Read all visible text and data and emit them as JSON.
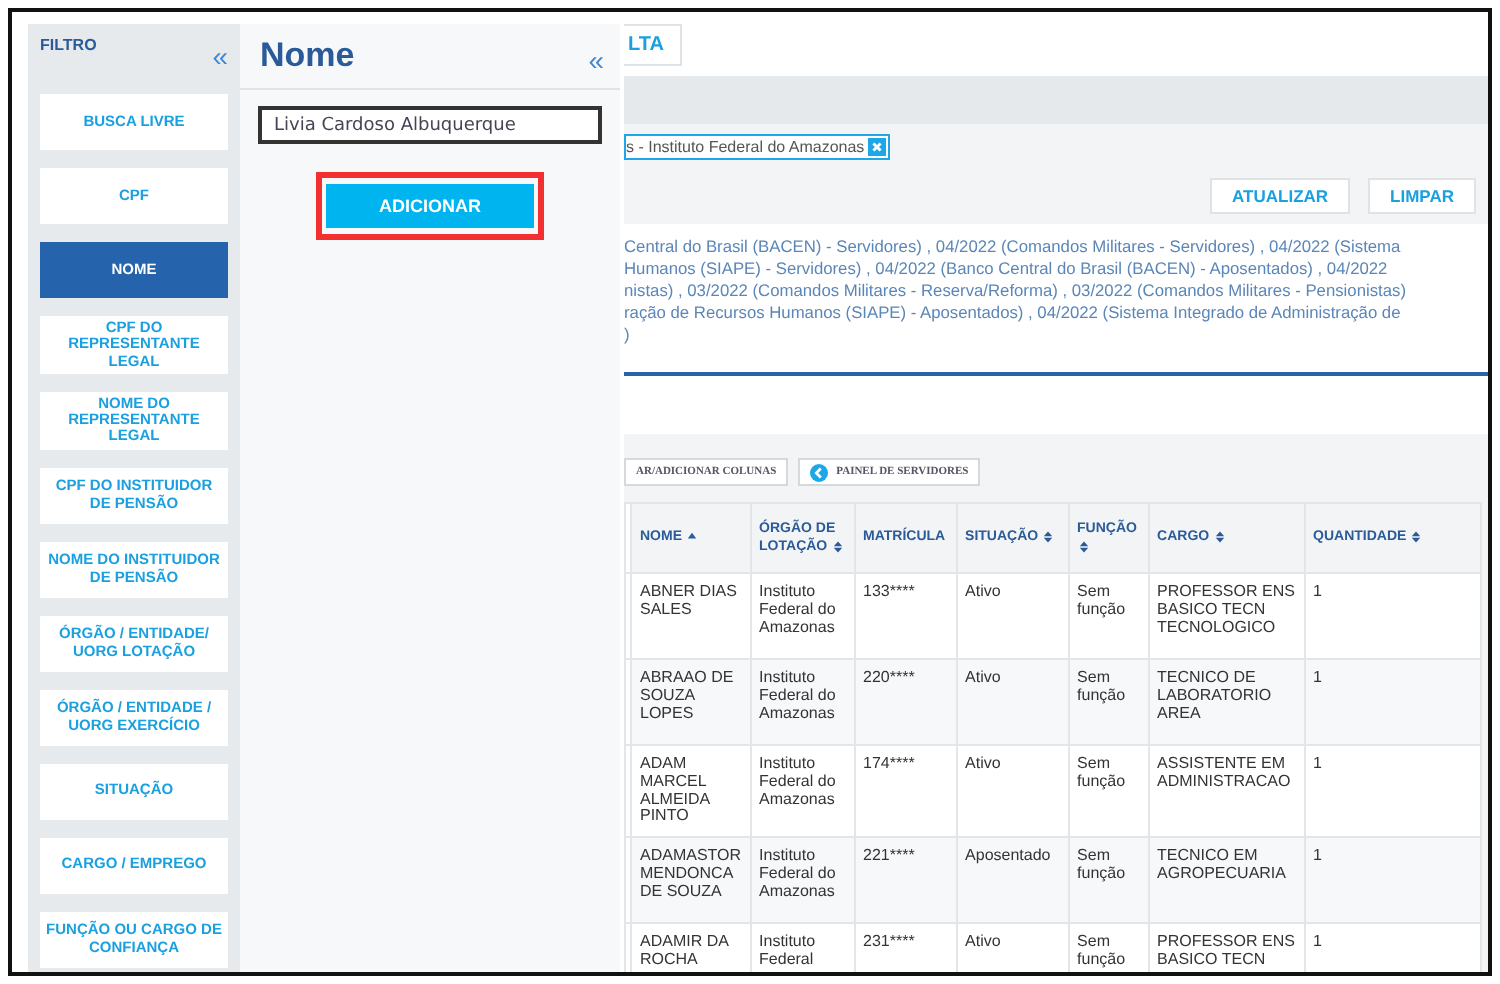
{
  "sidebar": {
    "title": "FILTRO",
    "collapse": "«",
    "items": [
      {
        "label": "BUSCA LIVRE",
        "selected": false
      },
      {
        "label": "CPF",
        "selected": false
      },
      {
        "label": "NOME",
        "selected": true
      },
      {
        "label": "CPF DO REPRESENTANTE LEGAL",
        "selected": false
      },
      {
        "label": "NOME DO REPRESENTANTE LEGAL",
        "selected": false
      },
      {
        "label": "CPF DO INSTITUIDOR DE PENSÃO",
        "selected": false
      },
      {
        "label": "NOME DO INSTITUIDOR DE PENSÃO",
        "selected": false
      },
      {
        "label": "ÓRGÃO / ENTIDADE/ UORG LOTAÇÃO",
        "selected": false
      },
      {
        "label": "ÓRGÃO / ENTIDADE / UORG EXERCÍCIO",
        "selected": false
      },
      {
        "label": "SITUAÇÃO",
        "selected": false
      },
      {
        "label": "CARGO / EMPREGO",
        "selected": false
      },
      {
        "label": "FUNÇÃO OU CARGO DE CONFIANÇA",
        "selected": false
      }
    ]
  },
  "panel": {
    "title": "Nome",
    "collapse": "«",
    "input": {
      "value": "Livia Cardoso Albuquerque"
    },
    "button": "ADICIONAR"
  },
  "main": {
    "top_button": "LTA",
    "filter_tag": "s - Instituto Federal do Amazonas",
    "actions": [
      "ATUALIZAR",
      "LIMPAR"
    ],
    "description_lines": [
      "Central do Brasil (BACEN) - Servidores) , 04/2022 (Comandos Militares - Servidores) , 04/2022 (Sistema",
      "Humanos (SIAPE) - Servidores) , 04/2022 (Banco Central do Brasil (BACEN) - Aposentados) , 04/2022",
      "nistas) , 03/2022 (Comandos Militares - Reserva/Reforma) , 03/2022 (Comandos Militares - Pensionistas)",
      "ração de Recursos Humanos (SIAPE) - Aposentados) , 04/2022 (Sistema Integrado de Administração de",
      ")"
    ],
    "table_tools": [
      "AR/ADICIONAR COLUNAS",
      "PAINEL DE SERVIDORES"
    ],
    "table": {
      "columns": [
        {
          "label": "NOME",
          "kind": "ascending"
        },
        {
          "label": "ÓRGÃO DE LOTAÇÃO",
          "kind": "sortable"
        },
        {
          "label": "MATRÍCULA",
          "kind": "plain"
        },
        {
          "label": "SITUAÇÃO",
          "kind": "sortable"
        },
        {
          "label": "FUNÇÃO",
          "kind": "sortable"
        },
        {
          "label": "CARGO",
          "kind": "sortable"
        },
        {
          "label": "QUANTIDADE",
          "kind": "sortable"
        }
      ],
      "rows": [
        [
          "ABNER DIAS SALES",
          "Instituto Federal do Amazonas",
          "133****",
          "Ativo",
          "Sem função",
          "PROFESSOR ENS BASICO TECN TECNOLOGICO",
          "1"
        ],
        [
          "ABRAAO DE SOUZA LOPES",
          "Instituto Federal do Amazonas",
          "220****",
          "Ativo",
          "Sem função",
          "TECNICO DE LABORATORIO AREA",
          "1"
        ],
        [
          "ADAM MARCEL ALMEIDA PINTO",
          "Instituto Federal do Amazonas",
          "174****",
          "Ativo",
          "Sem função",
          "ASSISTENTE EM ADMINISTRACAO",
          "1"
        ],
        [
          "ADAMASTOR MENDONCA DE SOUZA",
          "Instituto Federal do Amazonas",
          "221****",
          "Aposentado",
          "Sem função",
          "TECNICO EM AGROPECUARIA",
          "1"
        ],
        [
          "ADAMIR DA ROCHA",
          "Instituto Federal",
          "231****",
          "Ativo",
          "Sem função",
          "PROFESSOR ENS BASICO TECN",
          "1"
        ]
      ]
    }
  }
}
